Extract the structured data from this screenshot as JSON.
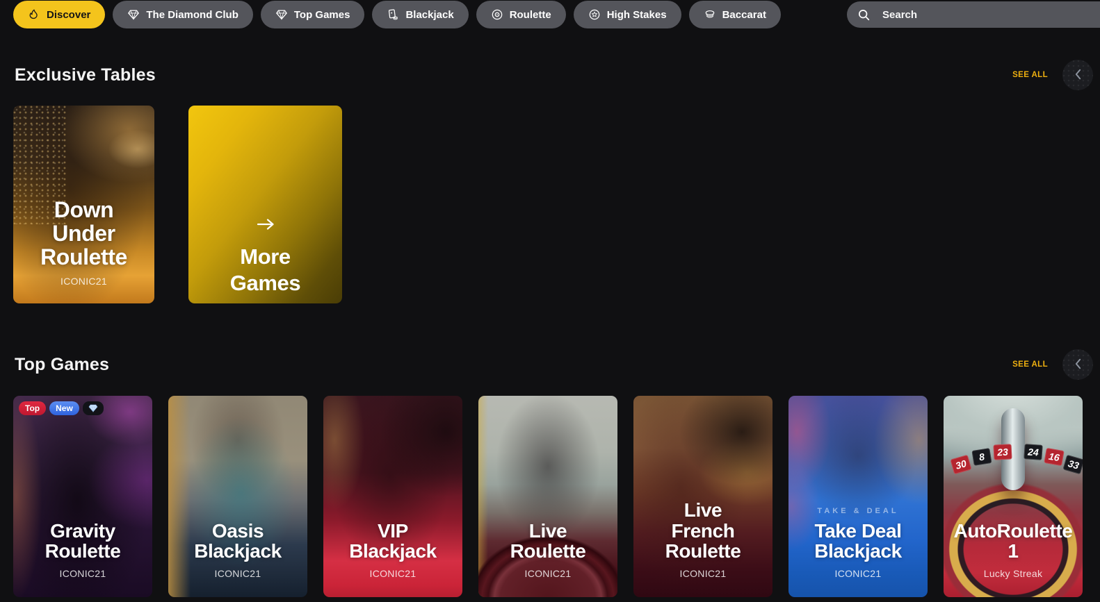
{
  "nav": {
    "items": [
      {
        "label": "Discover",
        "icon": "flame-icon",
        "active": true
      },
      {
        "label": "The Diamond Club",
        "icon": "diamond-icon",
        "active": false
      },
      {
        "label": "Top Games",
        "icon": "diamond-icon",
        "active": false
      },
      {
        "label": "Blackjack",
        "icon": "cards-chip-icon",
        "active": false
      },
      {
        "label": "Roulette",
        "icon": "roulette-wheel-icon",
        "active": false
      },
      {
        "label": "High Stakes",
        "icon": "chip-star-icon",
        "active": false
      },
      {
        "label": "Baccarat",
        "icon": "baccarat-icon",
        "active": false
      }
    ],
    "search_placeholder": "Search"
  },
  "sections": {
    "exclusive": {
      "title": "Exclusive Tables",
      "see_all": "SEE ALL",
      "cards": [
        {
          "title": "Down\nUnder\nRoulette",
          "provider": "ICONIC21"
        },
        {
          "title": "More\nGames",
          "icon": "arrow-right-icon"
        }
      ]
    },
    "top_games": {
      "title": "Top Games",
      "see_all": "SEE ALL",
      "cards": [
        {
          "title": "Gravity\nRoulette",
          "provider": "ICONIC21",
          "badges": {
            "top": "Top",
            "new": "New",
            "gem": "diamond-badge"
          }
        },
        {
          "title": "Oasis\nBlackjack",
          "provider": "ICONIC21"
        },
        {
          "title": "VIP\nBlackjack",
          "provider": "ICONIC21"
        },
        {
          "title": "Live\nRoulette",
          "provider": "ICONIC21"
        },
        {
          "title": "Live\nFrench\nRoulette",
          "provider": "ICONIC21"
        },
        {
          "title": "Take Deal\nBlackjack",
          "provider": "ICONIC21",
          "art_text": "TAKE & DEAL"
        },
        {
          "title": "AutoRoulette\n1",
          "provider": "Lucky Streak",
          "wheel_numbers": [
            "30",
            "8",
            "23",
            "24",
            "16",
            "33"
          ]
        }
      ]
    }
  },
  "colors": {
    "accent_yellow": "#F4C41C",
    "see_all_amber": "#EDAF10",
    "pill_gray": "#54555B",
    "badge_top_red": "#D6213A",
    "badge_new_blue": "#3D77E8",
    "page_background": "#101012"
  }
}
